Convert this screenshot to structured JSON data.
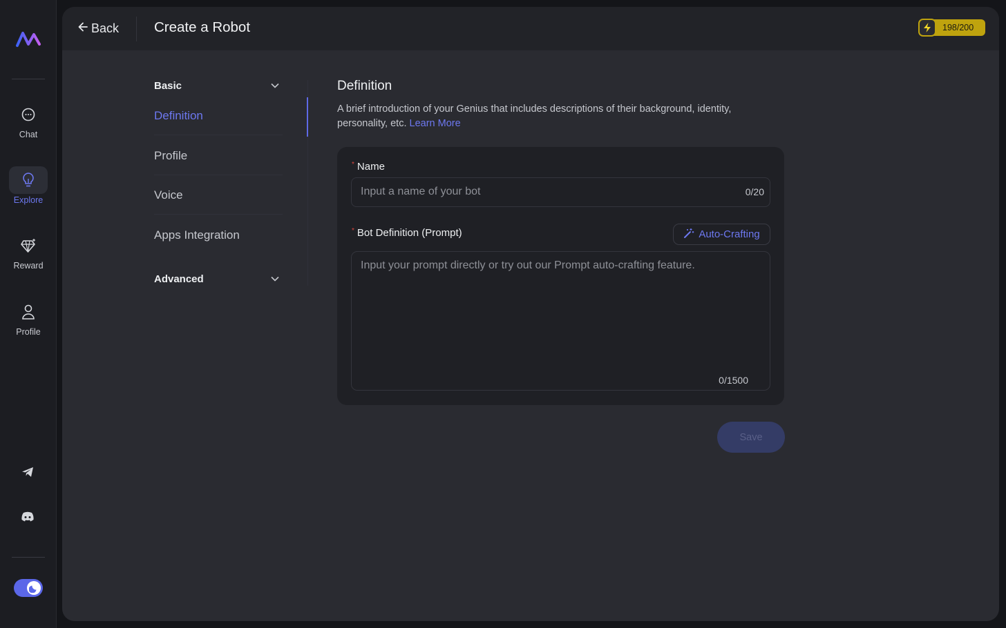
{
  "sidebar": {
    "items": [
      {
        "label": "Chat",
        "icon": "chat-bubble-icon"
      },
      {
        "label": "Explore",
        "icon": "lightbulb-icon",
        "active": true
      },
      {
        "label": "Reward",
        "icon": "diamond-icon"
      },
      {
        "label": "Profile",
        "icon": "user-icon"
      }
    ],
    "social": [
      "telegram-icon",
      "discord-icon"
    ],
    "theme_toggle": "dark"
  },
  "header": {
    "back_label": "Back",
    "title": "Create a Robot",
    "credits": "198/200"
  },
  "section_nav": {
    "basic_label": "Basic",
    "items": [
      "Definition",
      "Profile",
      "Voice",
      "Apps Integration"
    ],
    "active": "Definition",
    "advanced_label": "Advanced"
  },
  "main": {
    "heading": "Definition",
    "description": "A brief introduction of your Genius that includes descriptions of their background, identity, personality, etc.",
    "learn_more": "Learn More",
    "name_label": "Name",
    "name_placeholder": "Input a name of your bot",
    "name_count": "0/20",
    "prompt_label": "Bot Definition (Prompt)",
    "auto_crafting_label": "Auto-Crafting",
    "prompt_placeholder": "Input your prompt directly or try out our Prompt auto-crafting feature.",
    "prompt_count": "0/1500",
    "save_label": "Save"
  },
  "colors": {
    "accent": "#6d78f0",
    "credits_bg": "#bfa30e",
    "required": "#d9473f"
  }
}
